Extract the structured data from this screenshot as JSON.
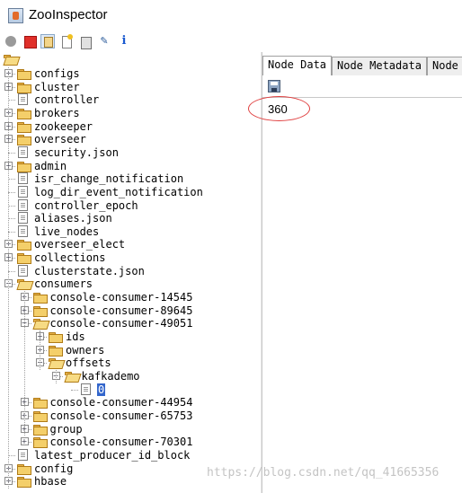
{
  "window": {
    "title": "ZooInspector"
  },
  "toolbar": {
    "icons": [
      "connect-icon",
      "disconnect-icon",
      "refresh-icon",
      "add-node-icon",
      "delete-node-icon",
      "edit-icon",
      "info-icon"
    ],
    "edit_glyph": "✎",
    "info_glyph": "i"
  },
  "tree": {
    "rows": [
      {
        "label": "configs"
      },
      {
        "label": "cluster"
      },
      {
        "label": "controller"
      },
      {
        "label": "brokers"
      },
      {
        "label": "zookeeper"
      },
      {
        "label": "overseer"
      },
      {
        "label": "security.json"
      },
      {
        "label": "admin"
      },
      {
        "label": "isr_change_notification"
      },
      {
        "label": "log_dir_event_notification"
      },
      {
        "label": "controller_epoch"
      },
      {
        "label": "aliases.json"
      },
      {
        "label": "live_nodes"
      },
      {
        "label": "overseer_elect"
      },
      {
        "label": "collections"
      },
      {
        "label": "clusterstate.json"
      },
      {
        "label": "consumers"
      },
      {
        "label": "console-consumer-14545"
      },
      {
        "label": "console-consumer-89645"
      },
      {
        "label": "console-consumer-49051"
      },
      {
        "label": "ids"
      },
      {
        "label": "owners"
      },
      {
        "label": "offsets"
      },
      {
        "label": "kafkademo"
      },
      {
        "label": "0"
      },
      {
        "label": "console-consumer-44954"
      },
      {
        "label": "console-consumer-65753"
      },
      {
        "label": "group"
      },
      {
        "label": "console-consumer-70301"
      },
      {
        "label": "latest_producer_id_block"
      },
      {
        "label": "config"
      },
      {
        "label": "hbase"
      }
    ],
    "expand_glyph": "+",
    "collapse_glyph": "−"
  },
  "details": {
    "tabs": [
      {
        "label": "Node Data"
      },
      {
        "label": "Node Metadata"
      },
      {
        "label": "Node"
      }
    ],
    "active_tab": "Node Data",
    "node_value": "360"
  },
  "watermark": "https://blog.csdn.net/qq_41665356",
  "colors": {
    "selection": "#3366cc",
    "annotation": "#e04040",
    "folder": "#f4cf6a"
  }
}
